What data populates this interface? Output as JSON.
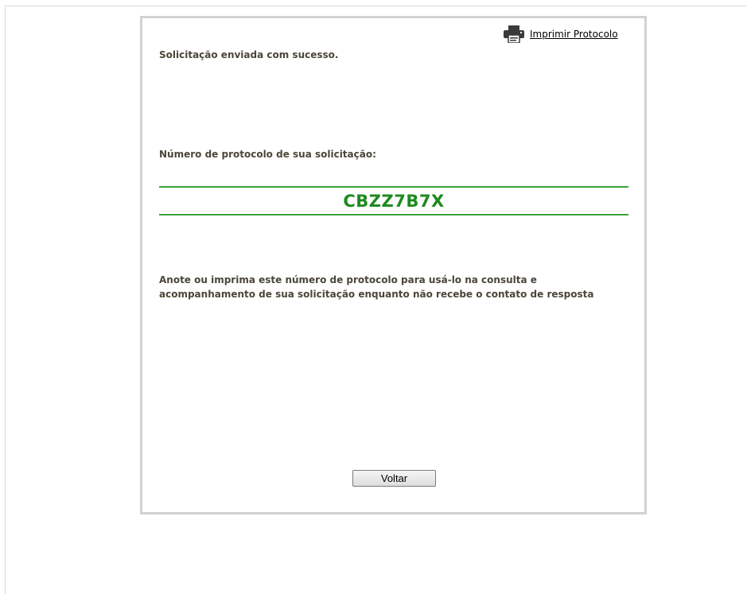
{
  "header": {
    "print_link_label": "Imprimir Protocolo",
    "print_icon": "printer-icon"
  },
  "main": {
    "success_message": "Solicitação enviada com sucesso.",
    "protocol_label": "Número de protocolo de sua solicitação:",
    "protocol_number": "CBZZ7B7X",
    "instructions": "Anote ou imprima este número de protocolo para usá-lo na consulta e acompanhamento de sua solicitação enquanto não recebe o contato de resposta"
  },
  "footer": {
    "back_button_label": "Voltar"
  },
  "colors": {
    "protocol_accent": "#3aa33a",
    "protocol_text": "#1e8a1e",
    "body_text": "#4b4638",
    "panel_border": "#d2d2d2"
  }
}
